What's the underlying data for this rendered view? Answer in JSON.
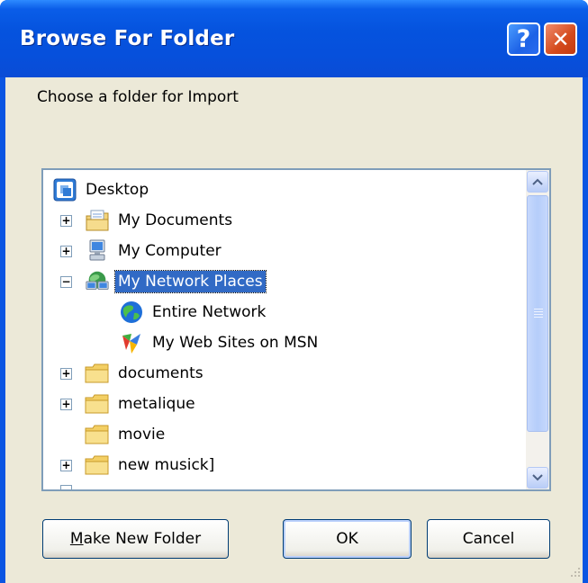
{
  "window": {
    "title": "Browse For Folder",
    "help_glyph": "?",
    "close_glyph": "✕"
  },
  "prompt": "Choose a folder for Import",
  "tree": {
    "items": [
      {
        "label": "Desktop",
        "icon": "desktop-icon"
      },
      {
        "label": "My Documents",
        "icon": "my-documents-icon",
        "expander": "+"
      },
      {
        "label": "My Computer",
        "icon": "my-computer-icon",
        "expander": "+"
      },
      {
        "label": "My Network Places",
        "icon": "network-places-icon",
        "expander": "−",
        "selected": true
      },
      {
        "label": "Entire Network",
        "icon": "entire-network-icon"
      },
      {
        "label": "My Web Sites on MSN",
        "icon": "msn-icon"
      },
      {
        "label": "documents",
        "icon": "folder-icon",
        "expander": "+"
      },
      {
        "label": "metalique",
        "icon": "folder-icon",
        "expander": "+"
      },
      {
        "label": "movie",
        "icon": "folder-icon"
      },
      {
        "label": "new musick]",
        "icon": "folder-icon",
        "expander": "+"
      }
    ]
  },
  "buttons": {
    "make_new_folder": "Make New Folder",
    "make_new_folder_mnemonic": "M",
    "make_new_folder_rest": "ake New Folder",
    "ok": "OK",
    "cancel": "Cancel"
  },
  "colors": {
    "titlebar": "#0553de",
    "dialog_bg": "#ece9d8",
    "selection": "#316ac5"
  }
}
